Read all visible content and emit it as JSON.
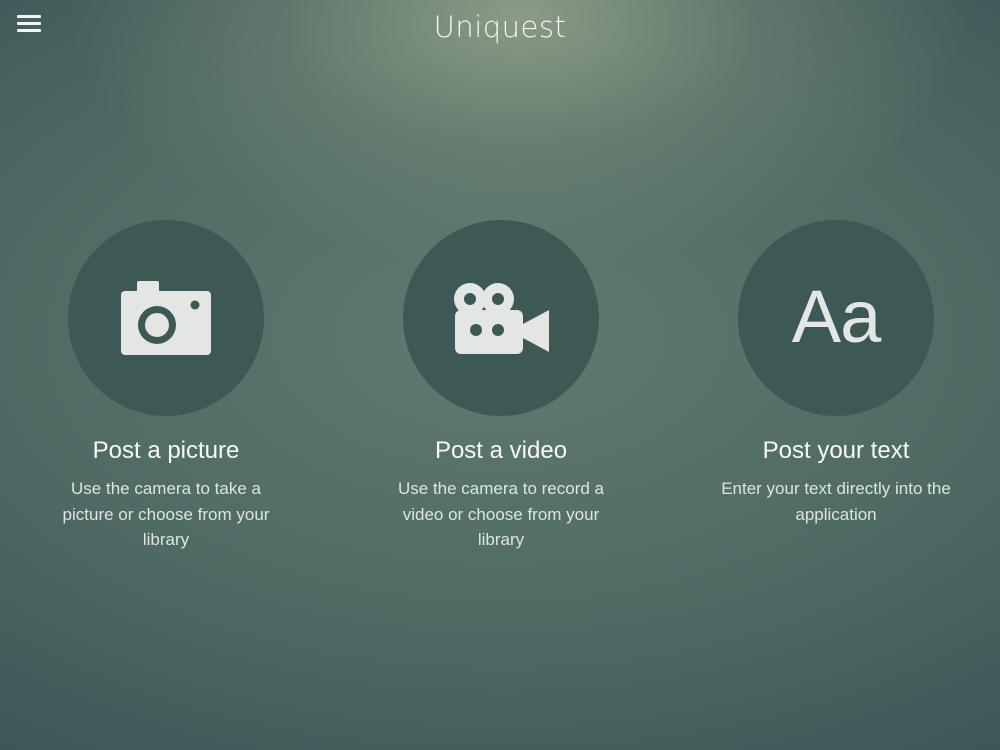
{
  "header": {
    "title": "Uniquest",
    "menu_icon": "hamburger-menu-icon"
  },
  "colors": {
    "circle": "#3c5955",
    "icon": "#e4e6e3",
    "text": "#f7f8f6"
  },
  "options": [
    {
      "icon": "camera-icon",
      "title": "Post a picture",
      "description": "Use the camera to take a picture or choose from your library"
    },
    {
      "icon": "video-camera-icon",
      "title": "Post a video",
      "description": "Use the camera to record a video or choose from your library"
    },
    {
      "icon": "text-icon",
      "icon_text": "Aa",
      "title": "Post your text",
      "description": "Enter your text directly into the application"
    }
  ]
}
